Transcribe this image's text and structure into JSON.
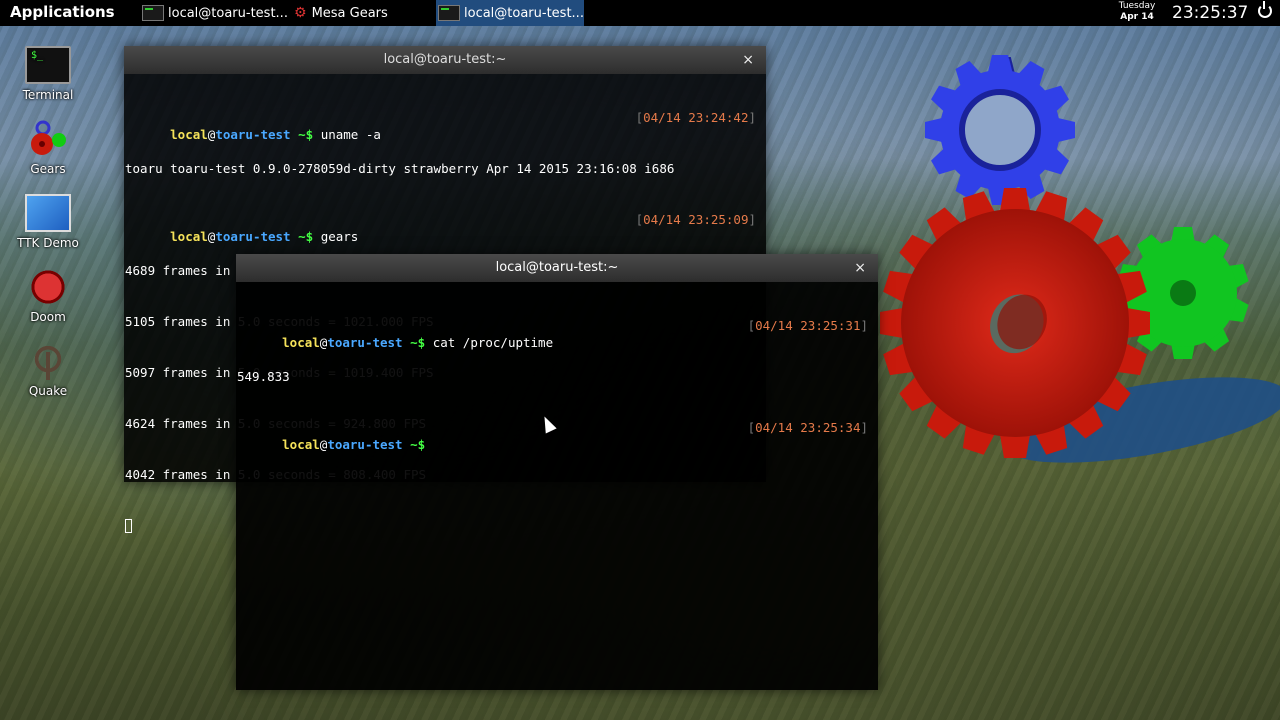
{
  "panel": {
    "apps_label": "Applications",
    "tasks": [
      {
        "label": "local@toaru-test...",
        "active": false
      },
      {
        "label": "Mesa Gears",
        "active": false
      },
      {
        "label": "local@toaru-test...",
        "active": true
      }
    ],
    "clock": {
      "weekday": "Tuesday",
      "date": "Apr 14",
      "time": "23:25:37"
    }
  },
  "desktop_icons": [
    {
      "label": "Terminal",
      "icon": "terminal-icon"
    },
    {
      "label": "Gears",
      "icon": "gears-icon"
    },
    {
      "label": "TTK Demo",
      "icon": "ttk-demo-icon"
    },
    {
      "label": "Doom",
      "icon": "doom-icon"
    },
    {
      "label": "Quake",
      "icon": "quake-icon"
    }
  ],
  "window1": {
    "title": "local@toaru-test:~",
    "close": "×",
    "prompt": {
      "user": "local",
      "at": "@",
      "host": "toaru-test",
      "path": " ~$ "
    },
    "lines": {
      "cmd1": "uname -a",
      "ts1": "04/14 23:24:42",
      "out1": "toaru toaru-test 0.9.0-278059d-dirty strawberry Apr 14 2015 23:16:08 i686",
      "cmd2": "gears",
      "ts2": "04/14 23:25:09",
      "fps": [
        "4689 frames in 5.0 seconds = 937.800 FPS",
        "5105 frames in 5.0 seconds = 1021.000 FPS",
        "5097 frames in 5.0 seconds = 1019.400 FPS",
        "4624 frames in 5.0 seconds = 924.800 FPS",
        "4042 frames in 5.0 seconds = 808.400 FPS"
      ]
    }
  },
  "window2": {
    "title": "local@toaru-test:~",
    "close": "×",
    "lines": {
      "cmd1": "cat /proc/uptime",
      "ts1": "04/14 23:25:31",
      "out1": "549.833",
      "ts2": "04/14 23:25:34"
    }
  },
  "brackets": {
    "open": "[",
    "close": "]"
  },
  "gears_colors": {
    "blue": "#2b3be0",
    "red": "#c81a0c",
    "green": "#0fbf1f"
  }
}
